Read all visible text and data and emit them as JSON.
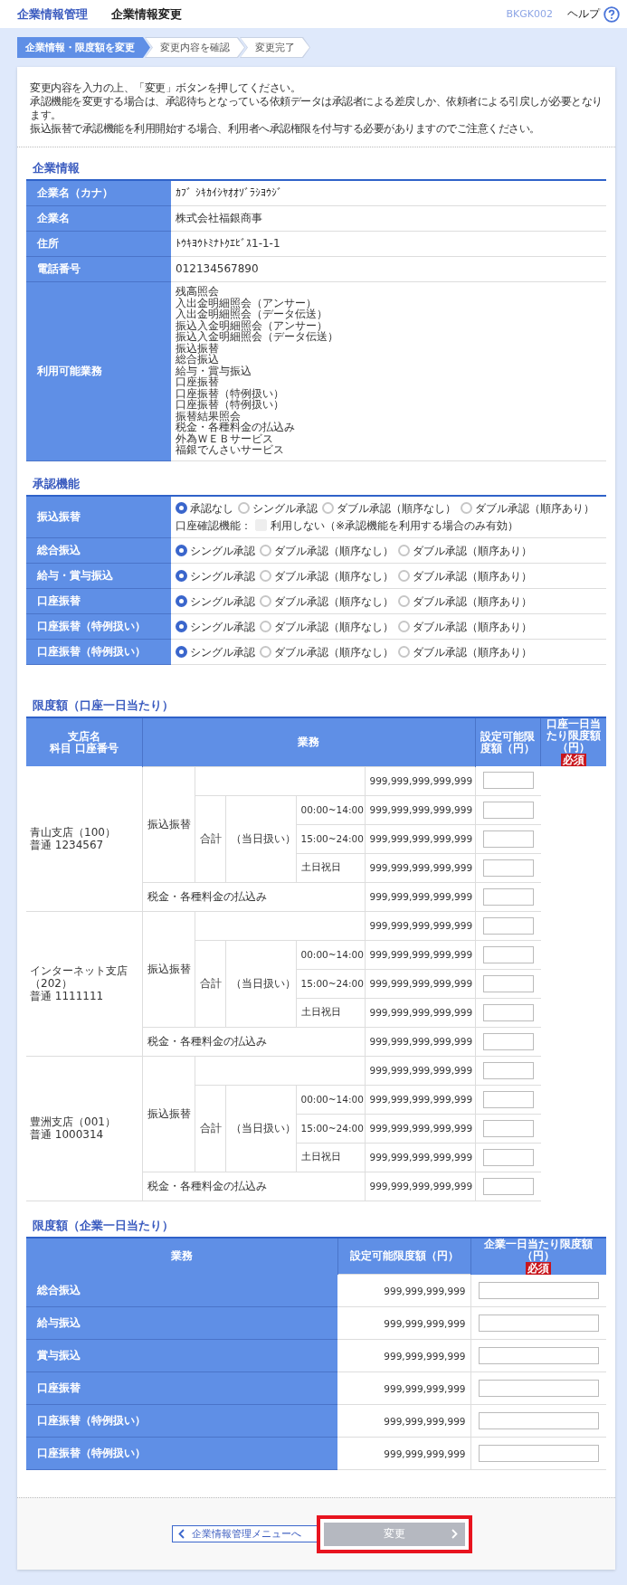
{
  "header": {
    "category": "企業情報管理",
    "title": "企業情報変更",
    "screen_id": "BKGK002",
    "help_label": "ヘルプ"
  },
  "steps": [
    {
      "label": "企業情報・限度額を変更",
      "selected": true
    },
    {
      "label": "変更内容を確認",
      "selected": false
    },
    {
      "label": "変更完了",
      "selected": false
    }
  ],
  "intro": [
    "変更内容を入力の上、「変更」ボタンを押してください。",
    "承認機能を変更する場合は、承認待ちとなっている依頼データは承認者による差戻しか、依頼者による引戻しが必要となります。",
    "振込振替で承認機能を利用開始する場合、利用者へ承認権限を付与する必要がありますのでご注意ください。"
  ],
  "company_info": {
    "title": "企業情報",
    "rows": [
      {
        "label": "企業名（カナ）",
        "lines": [
          "ｶﾌﾞ ｼｷｶｲｼﾔｵｵｿﾞﾗｼﾖｳｼﾞ"
        ]
      },
      {
        "label": "企業名",
        "lines": [
          "株式会社福銀商事"
        ]
      },
      {
        "label": "住所",
        "lines": [
          "ﾄｳｷﾖｳﾄﾐﾅﾄｸｴﾋﾞｽ1-1-1"
        ]
      },
      {
        "label": "電話番号",
        "lines": [
          "012134567890"
        ]
      },
      {
        "label": "利用可能業務",
        "lines": [
          "残高照会",
          "入出金明細照会（アンサー）",
          "入出金明細照会（データ伝送）",
          "振込入金明細照会（アンサー）",
          "振込入金明細照会（データ伝送）",
          "振込振替",
          "総合振込",
          "給与・賞与振込",
          "口座振替",
          "口座振替（特例扱い）",
          "口座振替（特例扱い）",
          "振替結果照会",
          "税金・各種料金の払込み",
          "外為ＷＥＢサービス",
          "福銀でんさいサービス"
        ]
      }
    ]
  },
  "approval": {
    "title": "承認機能",
    "rows": [
      {
        "label": "振込振替",
        "options": [
          {
            "label": "承認なし",
            "selected": true
          },
          {
            "label": "シングル承認",
            "selected": false
          },
          {
            "label": "ダブル承認（順序なし）",
            "selected": false
          },
          {
            "label": "ダブル承認（順序あり）",
            "selected": false
          }
        ],
        "account_check": {
          "label": "口座確認機能：",
          "option": "利用しない（※承認機能を利用する場合のみ有効）",
          "checked": false,
          "disabled": true
        }
      },
      {
        "label": "総合振込",
        "options": [
          {
            "label": "シングル承認",
            "selected": true
          },
          {
            "label": "ダブル承認（順序なし）",
            "selected": false
          },
          {
            "label": "ダブル承認（順序あり）",
            "selected": false
          }
        ]
      },
      {
        "label": "給与・賞与振込",
        "options": [
          {
            "label": "シングル承認",
            "selected": true
          },
          {
            "label": "ダブル承認（順序なし）",
            "selected": false
          },
          {
            "label": "ダブル承認（順序あり）",
            "selected": false
          }
        ]
      },
      {
        "label": "口座振替",
        "options": [
          {
            "label": "シングル承認",
            "selected": true
          },
          {
            "label": "ダブル承認（順序なし）",
            "selected": false
          },
          {
            "label": "ダブル承認（順序あり）",
            "selected": false
          }
        ]
      },
      {
        "label": "口座振替（特例扱い）",
        "options": [
          {
            "label": "シングル承認",
            "selected": true
          },
          {
            "label": "ダブル承認（順序なし）",
            "selected": false
          },
          {
            "label": "ダブル承認（順序あり）",
            "selected": false
          }
        ]
      },
      {
        "label": "口座振替（特例扱い）",
        "options": [
          {
            "label": "シングル承認",
            "selected": true
          },
          {
            "label": "ダブル承認（順序なし）",
            "selected": false
          },
          {
            "label": "ダブル承認（順序あり）",
            "selected": false
          }
        ]
      }
    ]
  },
  "account_limits": {
    "title": "限度額（口座一日当たり）",
    "columns": [
      [
        "支店名",
        "科目 口座番号"
      ],
      [
        "業務"
      ],
      [
        "設定可能限度額（円）"
      ],
      [
        "口座一日当たり限度額（円）"
      ]
    ],
    "required_badge": "必須",
    "accounts": [
      {
        "branch": [
          "青山支店（100）",
          "普通 1234567"
        ],
        "service": "振込振替",
        "total_amount": "999,999,999,999,999",
        "total_label": "合計",
        "same_day_label": "（当日扱い）",
        "slots": [
          {
            "label": "00:00~14:00",
            "amount": "999,999,999,999,999"
          },
          {
            "label": "15:00~24:00",
            "amount": "999,999,999,999,999"
          },
          {
            "label": "土日祝日",
            "amount": "999,999,999,999,999"
          }
        ],
        "tax": {
          "label": "税金・各種料金の払込み",
          "amount": "999,999,999,999,999"
        }
      },
      {
        "branch": [
          "インターネット支店（202）",
          "普通 1111111"
        ],
        "service": "振込振替",
        "total_amount": "999,999,999,999,999",
        "total_label": "合計",
        "same_day_label": "（当日扱い）",
        "slots": [
          {
            "label": "00:00~14:00",
            "amount": "999,999,999,999,999"
          },
          {
            "label": "15:00~24:00",
            "amount": "999,999,999,999,999"
          },
          {
            "label": "土日祝日",
            "amount": "999,999,999,999,999"
          }
        ],
        "tax": {
          "label": "税金・各種料金の払込み",
          "amount": "999,999,999,999,999"
        }
      },
      {
        "branch": [
          "豊洲支店（001）",
          "普通 1000314"
        ],
        "service": "振込振替",
        "total_amount": "999,999,999,999,999",
        "total_label": "合計",
        "same_day_label": "（当日扱い）",
        "slots": [
          {
            "label": "00:00~14:00",
            "amount": "999,999,999,999,999"
          },
          {
            "label": "15:00~24:00",
            "amount": "999,999,999,999,999"
          },
          {
            "label": "土日祝日",
            "amount": "999,999,999,999,999"
          }
        ],
        "tax": {
          "label": "税金・各種料金の払込み",
          "amount": "999,999,999,999,999"
        }
      }
    ]
  },
  "company_limits": {
    "title": "限度額（企業一日当たり）",
    "columns": [
      "業務",
      "設定可能限度額（円）",
      "企業一日当たり限度額（円）"
    ],
    "required_badge": "必須",
    "rows": [
      {
        "label": "総合振込",
        "amount": "999,999,999,999"
      },
      {
        "label": "給与振込",
        "amount": "999,999,999,999"
      },
      {
        "label": "賞与振込",
        "amount": "999,999,999,999"
      },
      {
        "label": "口座振替",
        "amount": "999,999,999,999"
      },
      {
        "label": "口座振替（特例扱い）",
        "amount": "999,999,999,999"
      },
      {
        "label": "口座振替（特例扱い）",
        "amount": "999,999,999,999"
      }
    ]
  },
  "footer": {
    "back_button": "企業情報管理メニューへ",
    "submit_button": {
      "label": "変更",
      "disabled": true,
      "highlighted": true
    }
  }
}
